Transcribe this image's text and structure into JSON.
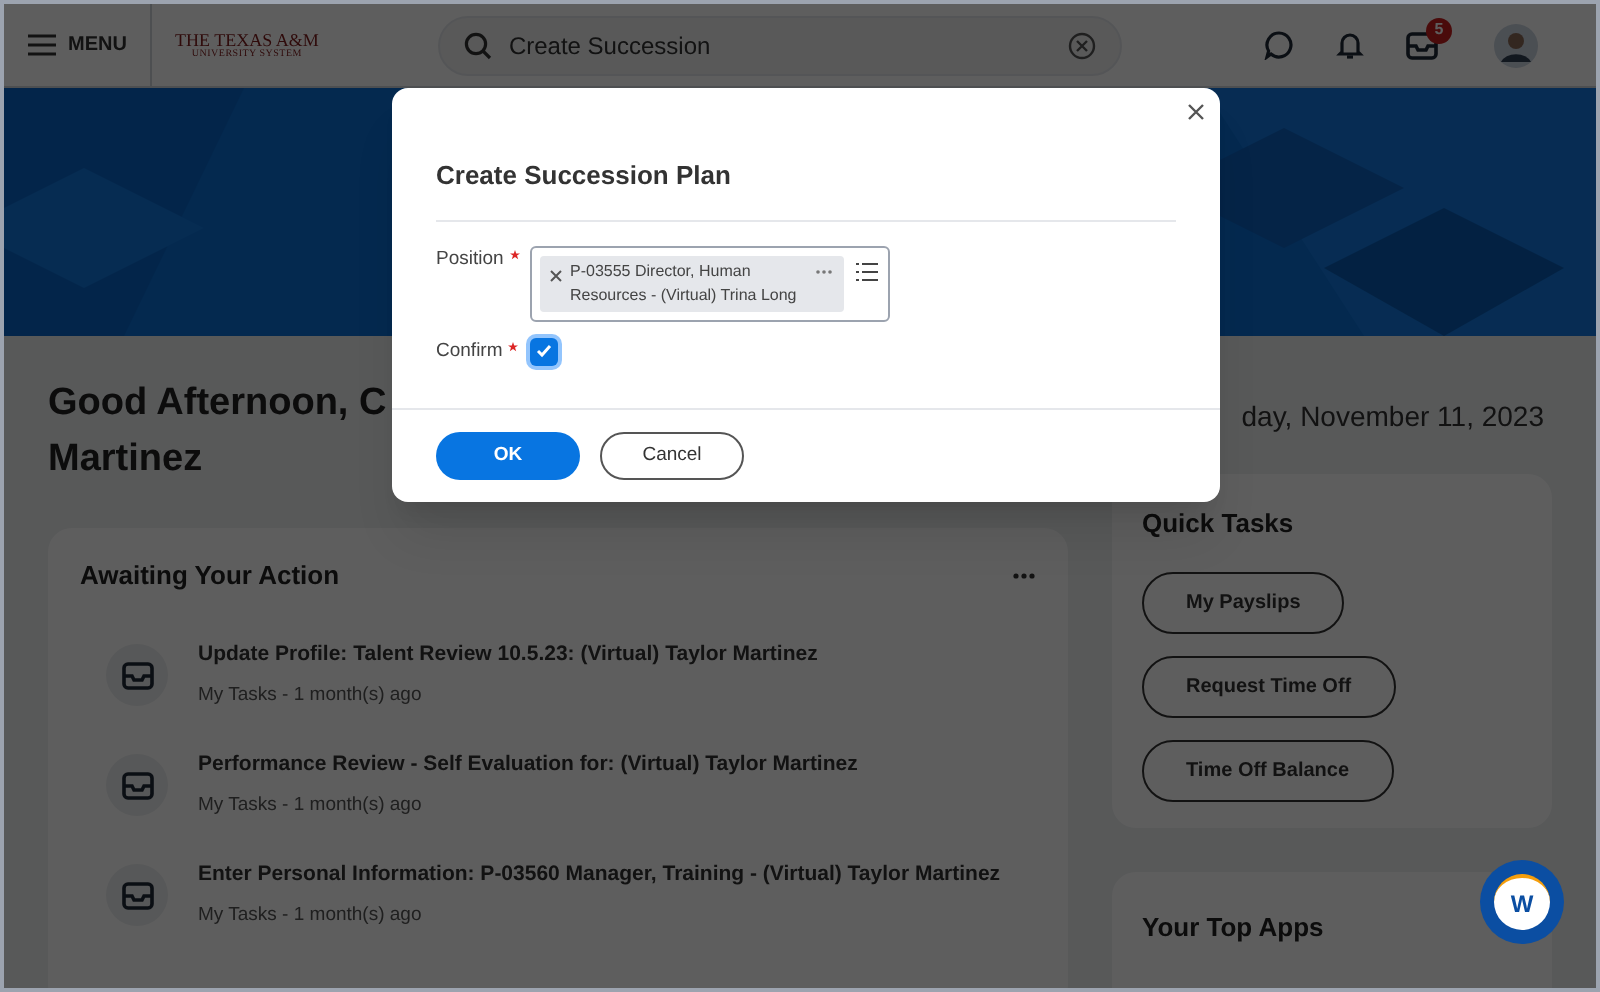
{
  "header": {
    "menu_label": "MENU",
    "logo_lines": [
      "THE TEXAS A&M",
      "UNIVERSITY SYSTEM"
    ],
    "search": {
      "value": "Create Succession"
    },
    "inbox_badge": "5"
  },
  "greeting": [
    "Good Afternoon, C",
    "Martinez"
  ],
  "date": "day, November 11, 2023",
  "awaiting": {
    "title": "Awaiting Your Action",
    "items": [
      {
        "title": "Update Profile: Talent Review 10.5.23: (Virtual) Taylor Martinez",
        "subtitle": "My Tasks - 1 month(s) ago"
      },
      {
        "title": "Performance Review - Self Evaluation for: (Virtual) Taylor Martinez",
        "subtitle": "My Tasks - 1 month(s) ago"
      },
      {
        "title": "Enter Personal Information: P-03560 Manager, Training - (Virtual) Taylor Martinez",
        "subtitle": "My Tasks - 1 month(s) ago"
      }
    ]
  },
  "quick_tasks": {
    "title": "Quick Tasks",
    "buttons": [
      "My Payslips",
      "Request Time Off",
      "Time Off Balance"
    ]
  },
  "top_apps": {
    "title": "Your Top Apps"
  },
  "help_button": {
    "label": "W"
  },
  "dialog": {
    "title": "Create Succession Plan",
    "fields": [
      {
        "kind": "selector",
        "label": "Position",
        "required": true,
        "value": "P-03555 Director, Human Resources - (Virtual) Trina Long"
      },
      {
        "kind": "checkbox",
        "label": "Confirm",
        "required": true,
        "checked": true
      }
    ],
    "buttons": [
      {
        "label": "OK",
        "primary": true
      },
      {
        "label": "Cancel",
        "primary": false
      }
    ]
  }
}
